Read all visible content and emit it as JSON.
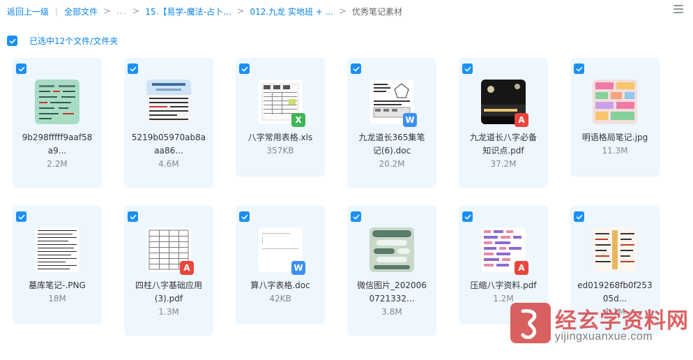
{
  "breadcrumb": {
    "back": "返回上一级",
    "all_files": "全部文件",
    "ellipsis": "...",
    "folder1": "15.【易学-魔法-占卜...",
    "folder2": "012.九龙 实地班 + ...",
    "current": "优秀笔记素材"
  },
  "selection": {
    "label": "已选中12个文件/文件夹"
  },
  "files": [
    {
      "name_line1": "9b298fffff9aaf58",
      "name_line2": "a9...",
      "size": "2.2M",
      "type": "image"
    },
    {
      "name_line1": "5219b05970ab8a",
      "name_line2": "aa86...",
      "size": "4.6M",
      "type": "image"
    },
    {
      "name_line1": "八字常用表格.xls",
      "name_line2": "",
      "size": "357KB",
      "type": "xls"
    },
    {
      "name_line1": "九龙道长365集笔",
      "name_line2": "记(6).doc",
      "size": "20.2M",
      "type": "doc"
    },
    {
      "name_line1": "九龙道长八字必备",
      "name_line2": "知识点.pdf",
      "size": "37.2M",
      "type": "pdf"
    },
    {
      "name_line1": "明语格局笔记.jpg",
      "name_line2": "",
      "size": "11.3M",
      "type": "image"
    },
    {
      "name_line1": "墓库笔记-.PNG",
      "name_line2": "",
      "size": "18M",
      "type": "image"
    },
    {
      "name_line1": "四柱八字基础应用",
      "name_line2": "(3).pdf",
      "size": "1.3M",
      "type": "pdf"
    },
    {
      "name_line1": "算八字表格.doc",
      "name_line2": "",
      "size": "42KB",
      "type": "doc"
    },
    {
      "name_line1": "微信图片_202006",
      "name_line2": "0721332...",
      "size": "3.8M",
      "type": "image"
    },
    {
      "name_line1": "压缩八字资料.pdf",
      "name_line2": "",
      "size": "1.2M",
      "type": "pdf"
    },
    {
      "name_line1": "ed019268fb0f253",
      "name_line2": "05d...",
      "size": "1.1M",
      "type": "image"
    }
  ],
  "badges": {
    "xls": "X",
    "doc": "W",
    "pdf": "A"
  },
  "watermark": {
    "title": "经玄学资料网",
    "url": "yijingxuanxue.com"
  },
  "colors": {
    "accent": "#1a90f5",
    "card_bg": "#eef6fe",
    "xls_badge": "#3fb55a",
    "doc_badge": "#3c8ef5",
    "pdf_badge": "#e8453c",
    "watermark": "#d54848"
  }
}
